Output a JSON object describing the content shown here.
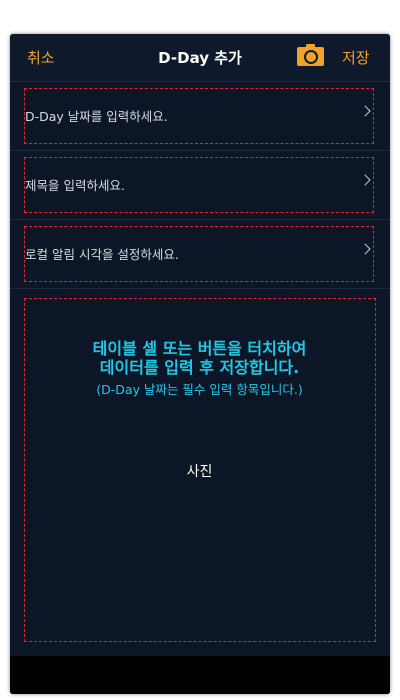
{
  "nav": {
    "cancel_label": "취소",
    "title": "D-Day 추가",
    "camera_icon": "camera-icon",
    "save_label": "저장",
    "accent_color": "#f0a22a"
  },
  "cells": [
    {
      "label": "D-Day 날짜를 입력하세요.",
      "icon": "chevron-right-icon"
    },
    {
      "label": "제목을 입력하세요.",
      "icon": "chevron-right-icon"
    },
    {
      "label": "로컬 알림 시각을 설정하세요.",
      "icon": "chevron-right-icon"
    }
  ],
  "photo": {
    "instruction_line1": "테이블 셀 또는 버튼을 터치하여",
    "instruction_line2": "데이터를 입력 후 저장합니다.",
    "instruction_note": "(D-Day 날짜는 필수 입력 항목입니다.)",
    "label": "사진"
  },
  "colors": {
    "background": "#0c1626",
    "highlight_dashed": "#e8242a",
    "instruction_text": "#22c8e6"
  }
}
